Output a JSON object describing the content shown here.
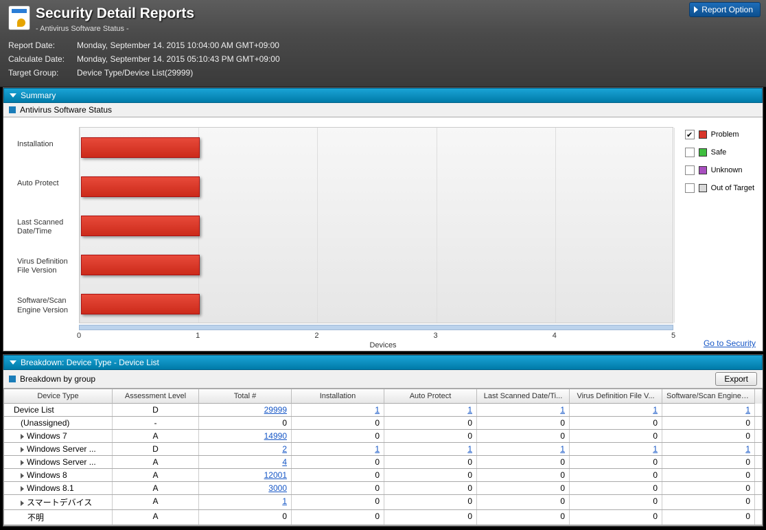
{
  "header": {
    "title": "Security Detail Reports",
    "subtitle": "- Antivirus Software Status -",
    "report_option": "Report Option"
  },
  "meta": {
    "report_date_label": "Report Date:",
    "report_date_value": "Monday, September 14. 2015 10:04:00 AM GMT+09:00",
    "calc_date_label": "Calculate Date:",
    "calc_date_value": "Monday, September 14. 2015 05:10:43 PM GMT+09:00",
    "target_group_label": "Target Group:",
    "target_group_value": "Device Type/Device List(29999)"
  },
  "summary": {
    "section_label": "Summary",
    "panel_title": "Antivirus Software Status",
    "go_link": "Go to Security"
  },
  "chart_data": {
    "type": "bar",
    "orientation": "horizontal",
    "categories": [
      "Installation",
      "Auto Protect",
      "Last Scanned Date/Time",
      "Virus Definition File Version",
      "Software/Scan Engine Version"
    ],
    "series": [
      {
        "name": "Problem",
        "color": "#d8362a",
        "values": [
          1,
          1,
          1,
          1,
          1
        ],
        "visible": true
      },
      {
        "name": "Safe",
        "color": "#3fbf3f",
        "values": [
          0,
          0,
          0,
          0,
          0
        ],
        "visible": false
      },
      {
        "name": "Unknown",
        "color": "#a84fbf",
        "values": [
          0,
          0,
          0,
          0,
          0
        ],
        "visible": false
      },
      {
        "name": "Out of Target",
        "color": "#d8d8d8",
        "values": [
          0,
          0,
          0,
          0,
          0
        ],
        "visible": false
      }
    ],
    "xlabel": "Devices",
    "xlim": [
      0,
      5
    ],
    "xticks": [
      0,
      1,
      2,
      3,
      4,
      5
    ]
  },
  "legend": {
    "items": [
      {
        "label": "Problem",
        "color": "#d8362a",
        "checked": true
      },
      {
        "label": "Safe",
        "color": "#3fbf3f",
        "checked": false
      },
      {
        "label": "Unknown",
        "color": "#a84fbf",
        "checked": false
      },
      {
        "label": "Out of Target",
        "color": "#d8d8d8",
        "checked": false
      }
    ]
  },
  "breakdown": {
    "section_label": "Breakdown: Device Type - Device List",
    "panel_title": "Breakdown by group",
    "export_label": "Export",
    "columns": [
      "Device Type",
      "Assessment Level",
      "Total #",
      "Installation",
      "Auto Protect",
      "Last Scanned Date/Ti...",
      "Virus Definition File V...",
      "Software/Scan Engine V..."
    ],
    "rows": [
      {
        "indent": 0,
        "expand": false,
        "name": "Device List",
        "level": "D",
        "total": "29999",
        "total_link": true,
        "c": [
          {
            "v": "1",
            "l": true
          },
          {
            "v": "1",
            "l": true
          },
          {
            "v": "1",
            "l": true
          },
          {
            "v": "1",
            "l": true
          },
          {
            "v": "1",
            "l": true
          }
        ]
      },
      {
        "indent": 1,
        "expand": false,
        "name": "(Unassigned)",
        "level": "-",
        "total": "0",
        "total_link": false,
        "c": [
          {
            "v": "0"
          },
          {
            "v": "0"
          },
          {
            "v": "0"
          },
          {
            "v": "0"
          },
          {
            "v": "0"
          }
        ]
      },
      {
        "indent": 1,
        "expand": true,
        "name": "Windows 7",
        "level": "A",
        "total": "14990",
        "total_link": true,
        "c": [
          {
            "v": "0"
          },
          {
            "v": "0"
          },
          {
            "v": "0"
          },
          {
            "v": "0"
          },
          {
            "v": "0"
          }
        ]
      },
      {
        "indent": 1,
        "expand": true,
        "name": "Windows Server ...",
        "level": "D",
        "total": "2",
        "total_link": true,
        "c": [
          {
            "v": "1",
            "l": true
          },
          {
            "v": "1",
            "l": true
          },
          {
            "v": "1",
            "l": true
          },
          {
            "v": "1",
            "l": true
          },
          {
            "v": "1",
            "l": true
          }
        ]
      },
      {
        "indent": 1,
        "expand": true,
        "name": "Windows Server ...",
        "level": "A",
        "total": "4",
        "total_link": true,
        "c": [
          {
            "v": "0"
          },
          {
            "v": "0"
          },
          {
            "v": "0"
          },
          {
            "v": "0"
          },
          {
            "v": "0"
          }
        ]
      },
      {
        "indent": 1,
        "expand": true,
        "name": "Windows 8",
        "level": "A",
        "total": "12001",
        "total_link": true,
        "c": [
          {
            "v": "0"
          },
          {
            "v": "0"
          },
          {
            "v": "0"
          },
          {
            "v": "0"
          },
          {
            "v": "0"
          }
        ]
      },
      {
        "indent": 1,
        "expand": true,
        "name": "Windows 8.1",
        "level": "A",
        "total": "3000",
        "total_link": true,
        "c": [
          {
            "v": "0"
          },
          {
            "v": "0"
          },
          {
            "v": "0"
          },
          {
            "v": "0"
          },
          {
            "v": "0"
          }
        ]
      },
      {
        "indent": 1,
        "expand": true,
        "name": "スマートデバイス",
        "level": "A",
        "total": "1",
        "total_link": true,
        "c": [
          {
            "v": "0"
          },
          {
            "v": "0"
          },
          {
            "v": "0"
          },
          {
            "v": "0"
          },
          {
            "v": "0"
          }
        ]
      },
      {
        "indent": 2,
        "expand": false,
        "name": "不明",
        "level": "A",
        "total": "0",
        "total_link": false,
        "c": [
          {
            "v": "0"
          },
          {
            "v": "0"
          },
          {
            "v": "0"
          },
          {
            "v": "0"
          },
          {
            "v": "0"
          }
        ]
      }
    ]
  }
}
